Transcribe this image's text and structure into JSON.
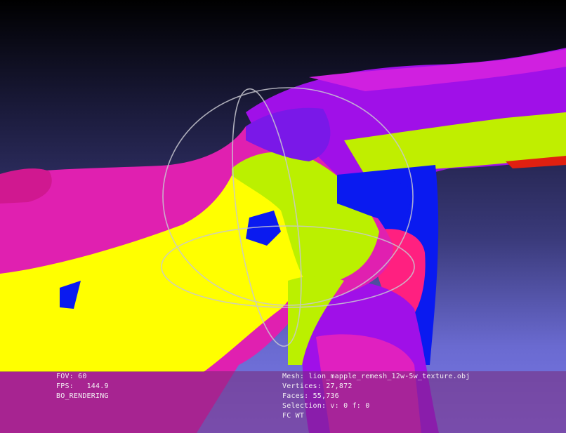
{
  "viewer": {
    "background_top": "#000000",
    "background_bottom": "#7a7aea"
  },
  "info_left": {
    "fov_label": "FOV:",
    "fov_value": "60",
    "fps_label": "FPS:",
    "fps_value": "144.9",
    "render_mode": "BO_RENDERING"
  },
  "info_right": {
    "mesh_label": "Mesh:",
    "mesh_name": "lion_mapple_remesh_12w-5w_texture.obj",
    "vertices_label": "Vertices:",
    "vertices_value": "27,872",
    "faces_label": "Faces:",
    "faces_value": "55,736",
    "selection_label": "Selection: v:",
    "selection_v": "0",
    "selection_f_label": "f:",
    "selection_f": "0",
    "mode": "FC WT"
  },
  "colors": {
    "magenta": "#e020b0",
    "violet": "#a010e8",
    "yellow": "#ffff00",
    "lime": "#bbf000",
    "blue": "#0a1af0",
    "red": "#e02010",
    "pink": "#ff2080"
  }
}
